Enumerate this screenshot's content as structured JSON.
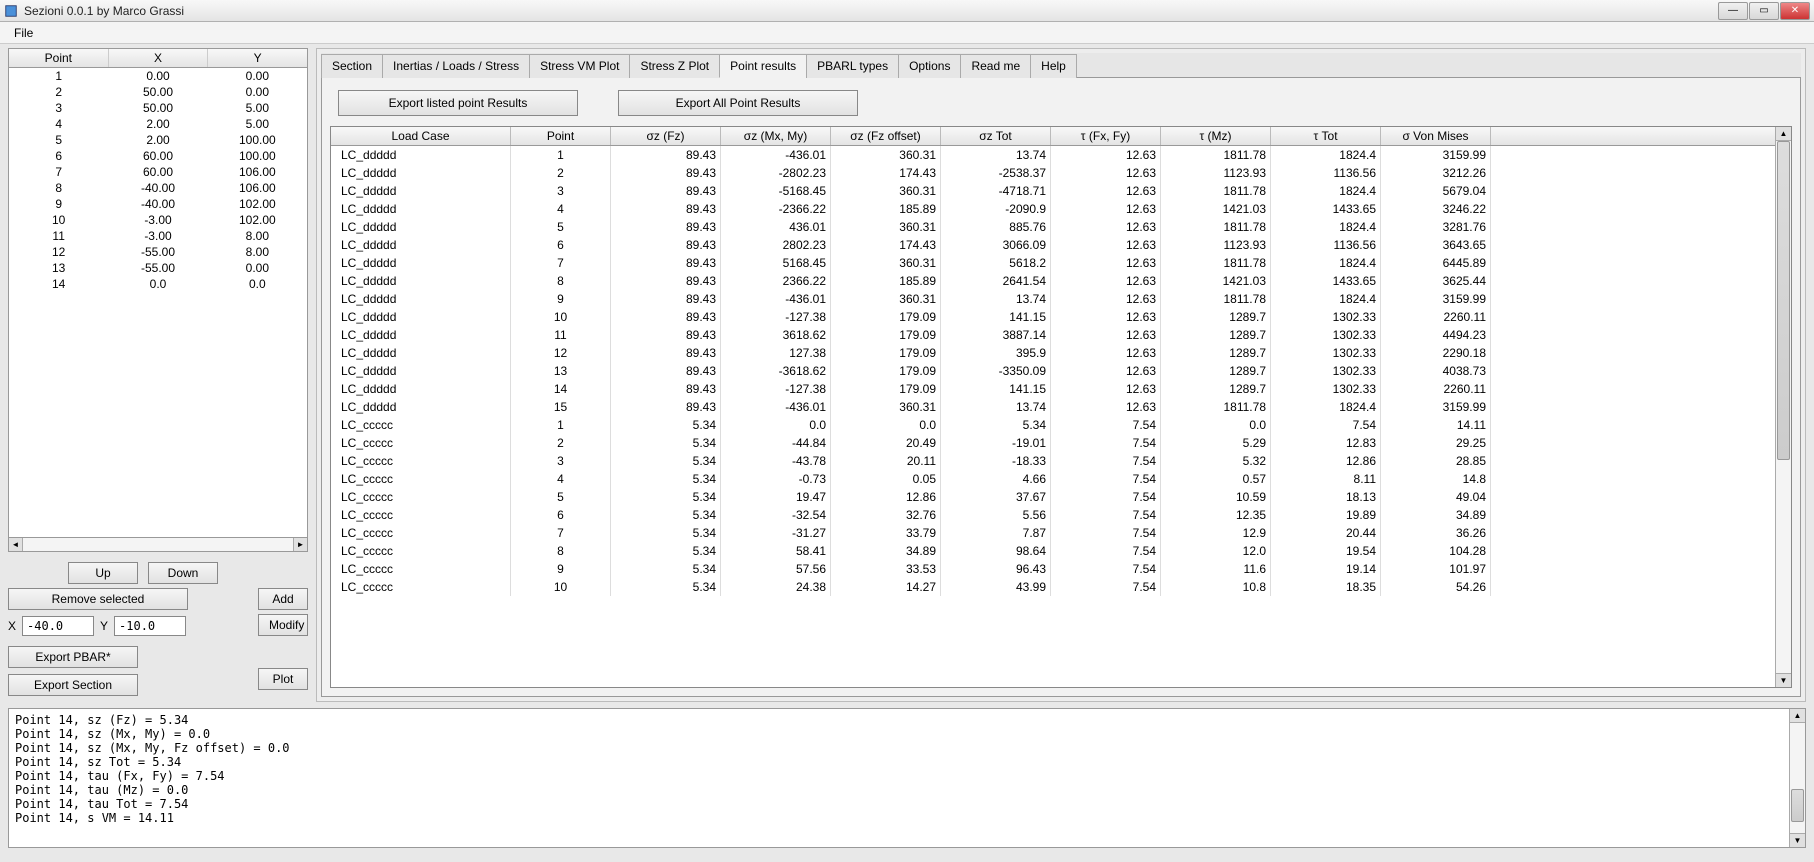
{
  "window": {
    "title": "Sezioni 0.0.1 by Marco Grassi",
    "menu_file": "File"
  },
  "left_table": {
    "headers": [
      "Point",
      "X",
      "Y"
    ],
    "rows": [
      [
        "1",
        "0.00",
        "0.00"
      ],
      [
        "2",
        "50.00",
        "0.00"
      ],
      [
        "3",
        "50.00",
        "5.00"
      ],
      [
        "4",
        "2.00",
        "5.00"
      ],
      [
        "5",
        "2.00",
        "100.00"
      ],
      [
        "6",
        "60.00",
        "100.00"
      ],
      [
        "7",
        "60.00",
        "106.00"
      ],
      [
        "8",
        "-40.00",
        "106.00"
      ],
      [
        "9",
        "-40.00",
        "102.00"
      ],
      [
        "10",
        "-3.00",
        "102.00"
      ],
      [
        "11",
        "-3.00",
        "8.00"
      ],
      [
        "12",
        "-55.00",
        "8.00"
      ],
      [
        "13",
        "-55.00",
        "0.00"
      ],
      [
        "14",
        "0.0",
        "0.0"
      ]
    ]
  },
  "controls": {
    "up": "Up",
    "down": "Down",
    "remove": "Remove selected",
    "x_label": "X",
    "y_label": "Y",
    "x_value": "-40.0",
    "y_value": "-10.0",
    "add": "Add",
    "modify": "Modify",
    "export_pbar": "Export PBAR*",
    "export_section": "Export Section",
    "plot": "Plot"
  },
  "tabs": {
    "items": [
      "Section",
      "Inertias / Loads / Stress",
      "Stress VM Plot",
      "Stress Z Plot",
      "Point results",
      "PBARL types",
      "Options",
      "Read me",
      "Help"
    ],
    "active_index": 4,
    "export_listed": "Export listed point Results",
    "export_all": "Export All Point Results"
  },
  "results": {
    "headers": [
      "Load Case",
      "Point",
      "σz (Fz)",
      "σz (Mx, My)",
      "σz (Fz offset)",
      "σz Tot",
      "τ (Fx, Fy)",
      "τ (Mz)",
      "τ Tot",
      "σ Von Mises"
    ],
    "rows": [
      [
        "LC_ddddd",
        "1",
        "89.43",
        "-436.01",
        "360.31",
        "13.74",
        "12.63",
        "1811.78",
        "1824.4",
        "3159.99"
      ],
      [
        "LC_ddddd",
        "2",
        "89.43",
        "-2802.23",
        "174.43",
        "-2538.37",
        "12.63",
        "1123.93",
        "1136.56",
        "3212.26"
      ],
      [
        "LC_ddddd",
        "3",
        "89.43",
        "-5168.45",
        "360.31",
        "-4718.71",
        "12.63",
        "1811.78",
        "1824.4",
        "5679.04"
      ],
      [
        "LC_ddddd",
        "4",
        "89.43",
        "-2366.22",
        "185.89",
        "-2090.9",
        "12.63",
        "1421.03",
        "1433.65",
        "3246.22"
      ],
      [
        "LC_ddddd",
        "5",
        "89.43",
        "436.01",
        "360.31",
        "885.76",
        "12.63",
        "1811.78",
        "1824.4",
        "3281.76"
      ],
      [
        "LC_ddddd",
        "6",
        "89.43",
        "2802.23",
        "174.43",
        "3066.09",
        "12.63",
        "1123.93",
        "1136.56",
        "3643.65"
      ],
      [
        "LC_ddddd",
        "7",
        "89.43",
        "5168.45",
        "360.31",
        "5618.2",
        "12.63",
        "1811.78",
        "1824.4",
        "6445.89"
      ],
      [
        "LC_ddddd",
        "8",
        "89.43",
        "2366.22",
        "185.89",
        "2641.54",
        "12.63",
        "1421.03",
        "1433.65",
        "3625.44"
      ],
      [
        "LC_ddddd",
        "9",
        "89.43",
        "-436.01",
        "360.31",
        "13.74",
        "12.63",
        "1811.78",
        "1824.4",
        "3159.99"
      ],
      [
        "LC_ddddd",
        "10",
        "89.43",
        "-127.38",
        "179.09",
        "141.15",
        "12.63",
        "1289.7",
        "1302.33",
        "2260.11"
      ],
      [
        "LC_ddddd",
        "11",
        "89.43",
        "3618.62",
        "179.09",
        "3887.14",
        "12.63",
        "1289.7",
        "1302.33",
        "4494.23"
      ],
      [
        "LC_ddddd",
        "12",
        "89.43",
        "127.38",
        "179.09",
        "395.9",
        "12.63",
        "1289.7",
        "1302.33",
        "2290.18"
      ],
      [
        "LC_ddddd",
        "13",
        "89.43",
        "-3618.62",
        "179.09",
        "-3350.09",
        "12.63",
        "1289.7",
        "1302.33",
        "4038.73"
      ],
      [
        "LC_ddddd",
        "14",
        "89.43",
        "-127.38",
        "179.09",
        "141.15",
        "12.63",
        "1289.7",
        "1302.33",
        "2260.11"
      ],
      [
        "LC_ddddd",
        "15",
        "89.43",
        "-436.01",
        "360.31",
        "13.74",
        "12.63",
        "1811.78",
        "1824.4",
        "3159.99"
      ],
      [
        "LC_ccccc",
        "1",
        "5.34",
        "0.0",
        "0.0",
        "5.34",
        "7.54",
        "0.0",
        "7.54",
        "14.11"
      ],
      [
        "LC_ccccc",
        "2",
        "5.34",
        "-44.84",
        "20.49",
        "-19.01",
        "7.54",
        "5.29",
        "12.83",
        "29.25"
      ],
      [
        "LC_ccccc",
        "3",
        "5.34",
        "-43.78",
        "20.11",
        "-18.33",
        "7.54",
        "5.32",
        "12.86",
        "28.85"
      ],
      [
        "LC_ccccc",
        "4",
        "5.34",
        "-0.73",
        "0.05",
        "4.66",
        "7.54",
        "0.57",
        "8.11",
        "14.8"
      ],
      [
        "LC_ccccc",
        "5",
        "5.34",
        "19.47",
        "12.86",
        "37.67",
        "7.54",
        "10.59",
        "18.13",
        "49.04"
      ],
      [
        "LC_ccccc",
        "6",
        "5.34",
        "-32.54",
        "32.76",
        "5.56",
        "7.54",
        "12.35",
        "19.89",
        "34.89"
      ],
      [
        "LC_ccccc",
        "7",
        "5.34",
        "-31.27",
        "33.79",
        "7.87",
        "7.54",
        "12.9",
        "20.44",
        "36.26"
      ],
      [
        "LC_ccccc",
        "8",
        "5.34",
        "58.41",
        "34.89",
        "98.64",
        "7.54",
        "12.0",
        "19.54",
        "104.28"
      ],
      [
        "LC_ccccc",
        "9",
        "5.34",
        "57.56",
        "33.53",
        "96.43",
        "7.54",
        "11.6",
        "19.14",
        "101.97"
      ],
      [
        "LC_ccccc",
        "10",
        "5.34",
        "24.38",
        "14.27",
        "43.99",
        "7.54",
        "10.8",
        "18.35",
        "54.26"
      ]
    ]
  },
  "console": {
    "lines": [
      "Point 14, sz (Fz) = 5.34",
      "Point 14, sz (Mx, My) = 0.0",
      "Point 14, sz (Mx, My, Fz offset) = 0.0",
      "Point 14, sz Tot = 5.34",
      "Point 14, tau (Fx, Fy) = 7.54",
      "Point 14, tau (Mz) = 0.0",
      "Point 14, tau Tot = 7.54",
      "Point 14, s VM = 14.11"
    ]
  }
}
